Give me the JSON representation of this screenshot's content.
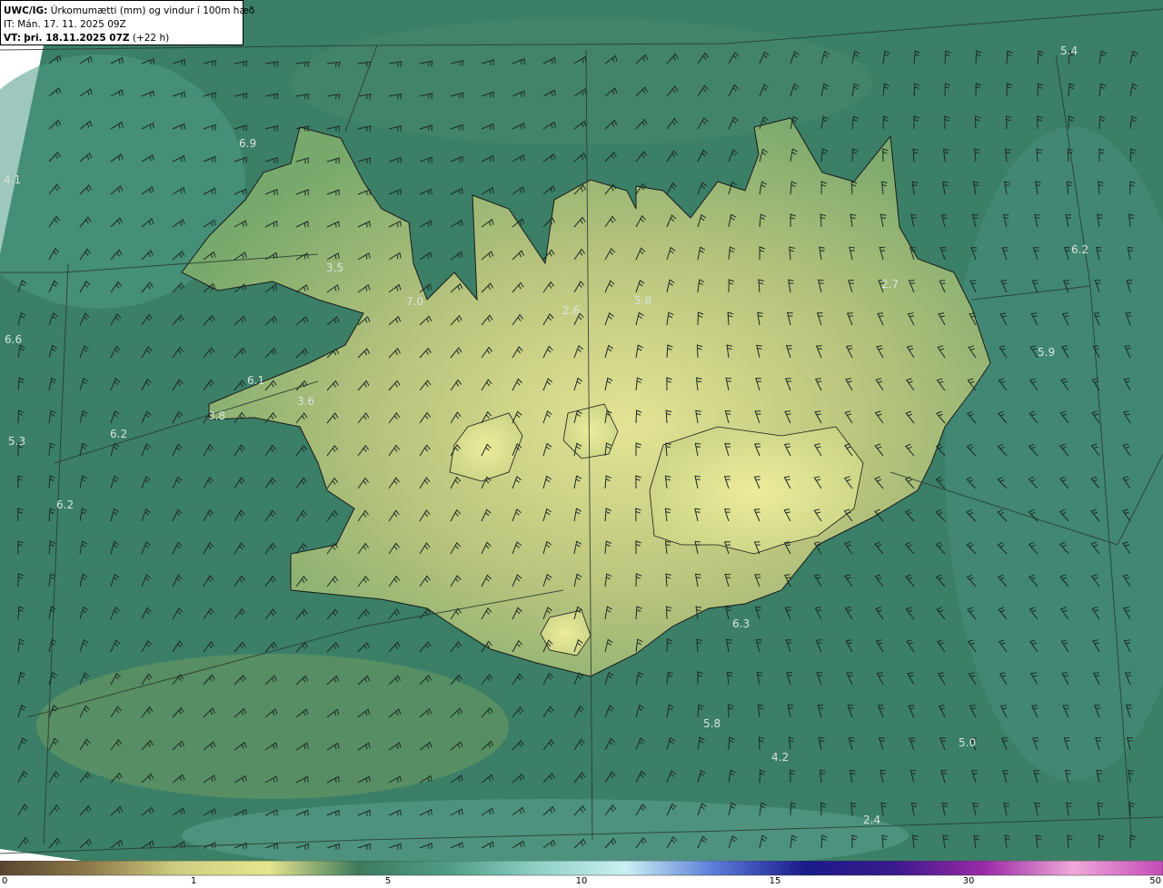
{
  "header": {
    "model": "UWC/IG:",
    "title": "Úrkomumætti (mm) og vindur í 100m hæð",
    "issue_time": "IT: Mán. 17. 11. 2025 09Z",
    "valid_label": "VT:",
    "valid_time": "þri. 18.11.2025 07Z",
    "lead": "(+22 h)"
  },
  "map_labels": [
    "5.4",
    "6.9",
    "4.1",
    "3.5",
    "7.0",
    "2.6",
    "5.8",
    "2.7",
    "6.2",
    "6.6",
    "5.9",
    "6.1",
    "3.6",
    "3.8",
    "6.2",
    "5.3",
    "6.2",
    "6.3",
    "5.8",
    "4.2",
    "5.0",
    "2.4"
  ],
  "colorbar": {
    "ticks": [
      "0",
      "1",
      "5",
      "10",
      "15",
      "30",
      "50"
    ],
    "tick_values": [
      0,
      1,
      5,
      10,
      15,
      30,
      50
    ],
    "colors": [
      "#5a4630",
      "#8f7a4a",
      "#cfcf82",
      "#e6e48e",
      "#3d7a5c",
      "#4f9c86",
      "#8fd0c5",
      "#c9f0f2",
      "#5b7ad9",
      "#1a1a8a",
      "#3a1a8c",
      "#9a2aa6",
      "#f0a8d8",
      "#c44bb8"
    ]
  },
  "map_colors": {
    "sea": "#3b7f67",
    "land_low": "#77a86c",
    "land_high": "#e3e394",
    "outside": "#ffffff"
  }
}
